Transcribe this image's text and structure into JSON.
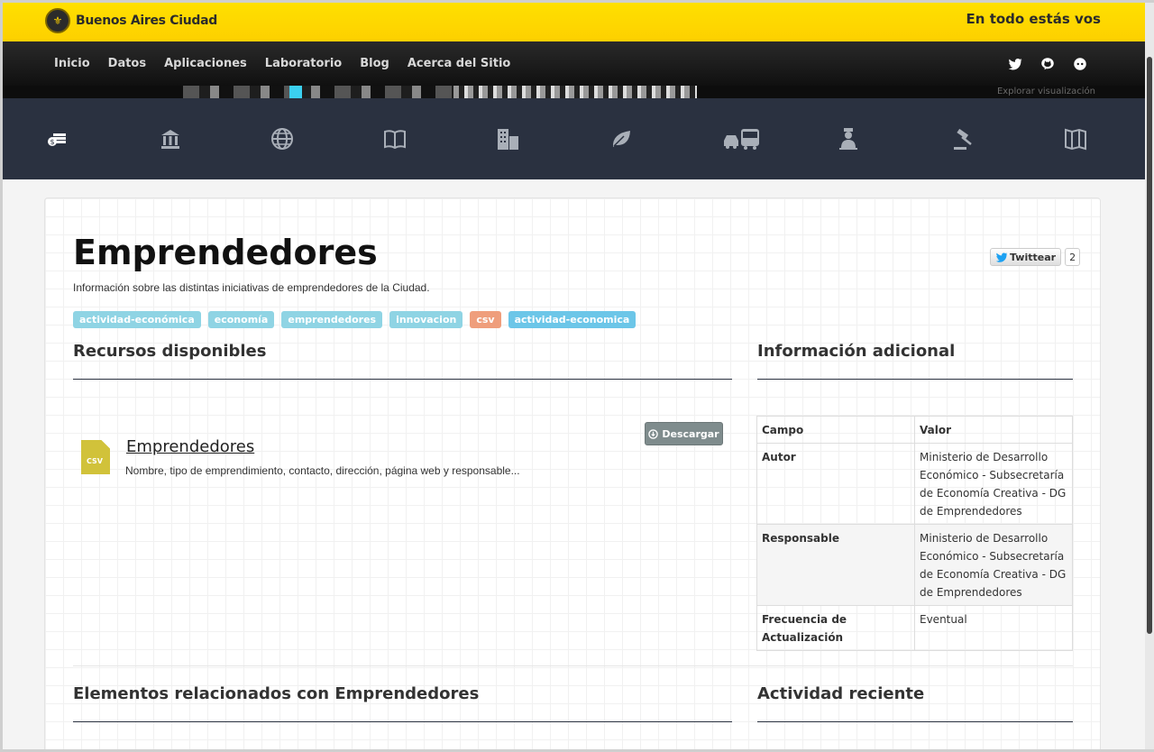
{
  "header": {
    "brand": "Buenos Aires Ciudad",
    "slogan": "En todo estás vos"
  },
  "nav": {
    "items": [
      "Inicio",
      "Datos",
      "Aplicaciones",
      "Laboratorio",
      "Blog",
      "Acerca del Sitio"
    ],
    "social_icons": [
      "twitter-icon",
      "github-icon",
      "chat-icon"
    ]
  },
  "banner": {
    "explore_label": "Explorar visualización"
  },
  "categories": {
    "icons": [
      "economy-icon",
      "government-icon",
      "globe-icon",
      "education-icon",
      "urbanism-icon",
      "environment-icon",
      "transport-icon",
      "health-icon",
      "justice-icon",
      "culture-icon"
    ],
    "active_color": "#ffffff",
    "inactive_color": "#a9afb8"
  },
  "dataset": {
    "title": "Emprendedores",
    "description": "Información sobre las distintas iniciativas de emprendedores de la Ciudad.",
    "tweet_label": "Twittear",
    "tweet_count": "2",
    "tags": [
      "actividad-económica",
      "economía",
      "emprendedores",
      "innovacion",
      "csv",
      "actividad-economica"
    ]
  },
  "resources": {
    "heading": "Recursos disponibles",
    "download_label": "Descargar",
    "items": [
      {
        "format": "CSV",
        "name": "Emprendedores",
        "description": "Nombre, tipo de emprendimiento, contacto, dirección, página web y responsable..."
      }
    ]
  },
  "additional_info": {
    "heading": "Información adicional",
    "columns": [
      "Campo",
      "Valor"
    ],
    "rows": [
      {
        "field": "Autor",
        "value": "Ministerio de Desarrollo Económico - Subsecretaría de Economía Creativa - DG de Emprendedores"
      },
      {
        "field": "Responsable",
        "value": "Ministerio de Desarrollo Económico - Subsecretaría de Economía Creativa - DG de Emprendedores"
      },
      {
        "field": "Frecuencia de Actualización",
        "value": "Eventual"
      }
    ]
  },
  "related": {
    "heading": "Elementos relacionados con Emprendedores"
  },
  "activity": {
    "heading": "Actividad reciente"
  },
  "colors": {
    "header_yellow": "#fdd000",
    "nav_dark": "#1a1a1a",
    "category_bar": "#2a3140",
    "tag_teal": "#8fd4e4",
    "tag_orange": "#ef9e7c",
    "tag_blue": "#6cc6e8",
    "csv_icon": "#d1c23a"
  }
}
